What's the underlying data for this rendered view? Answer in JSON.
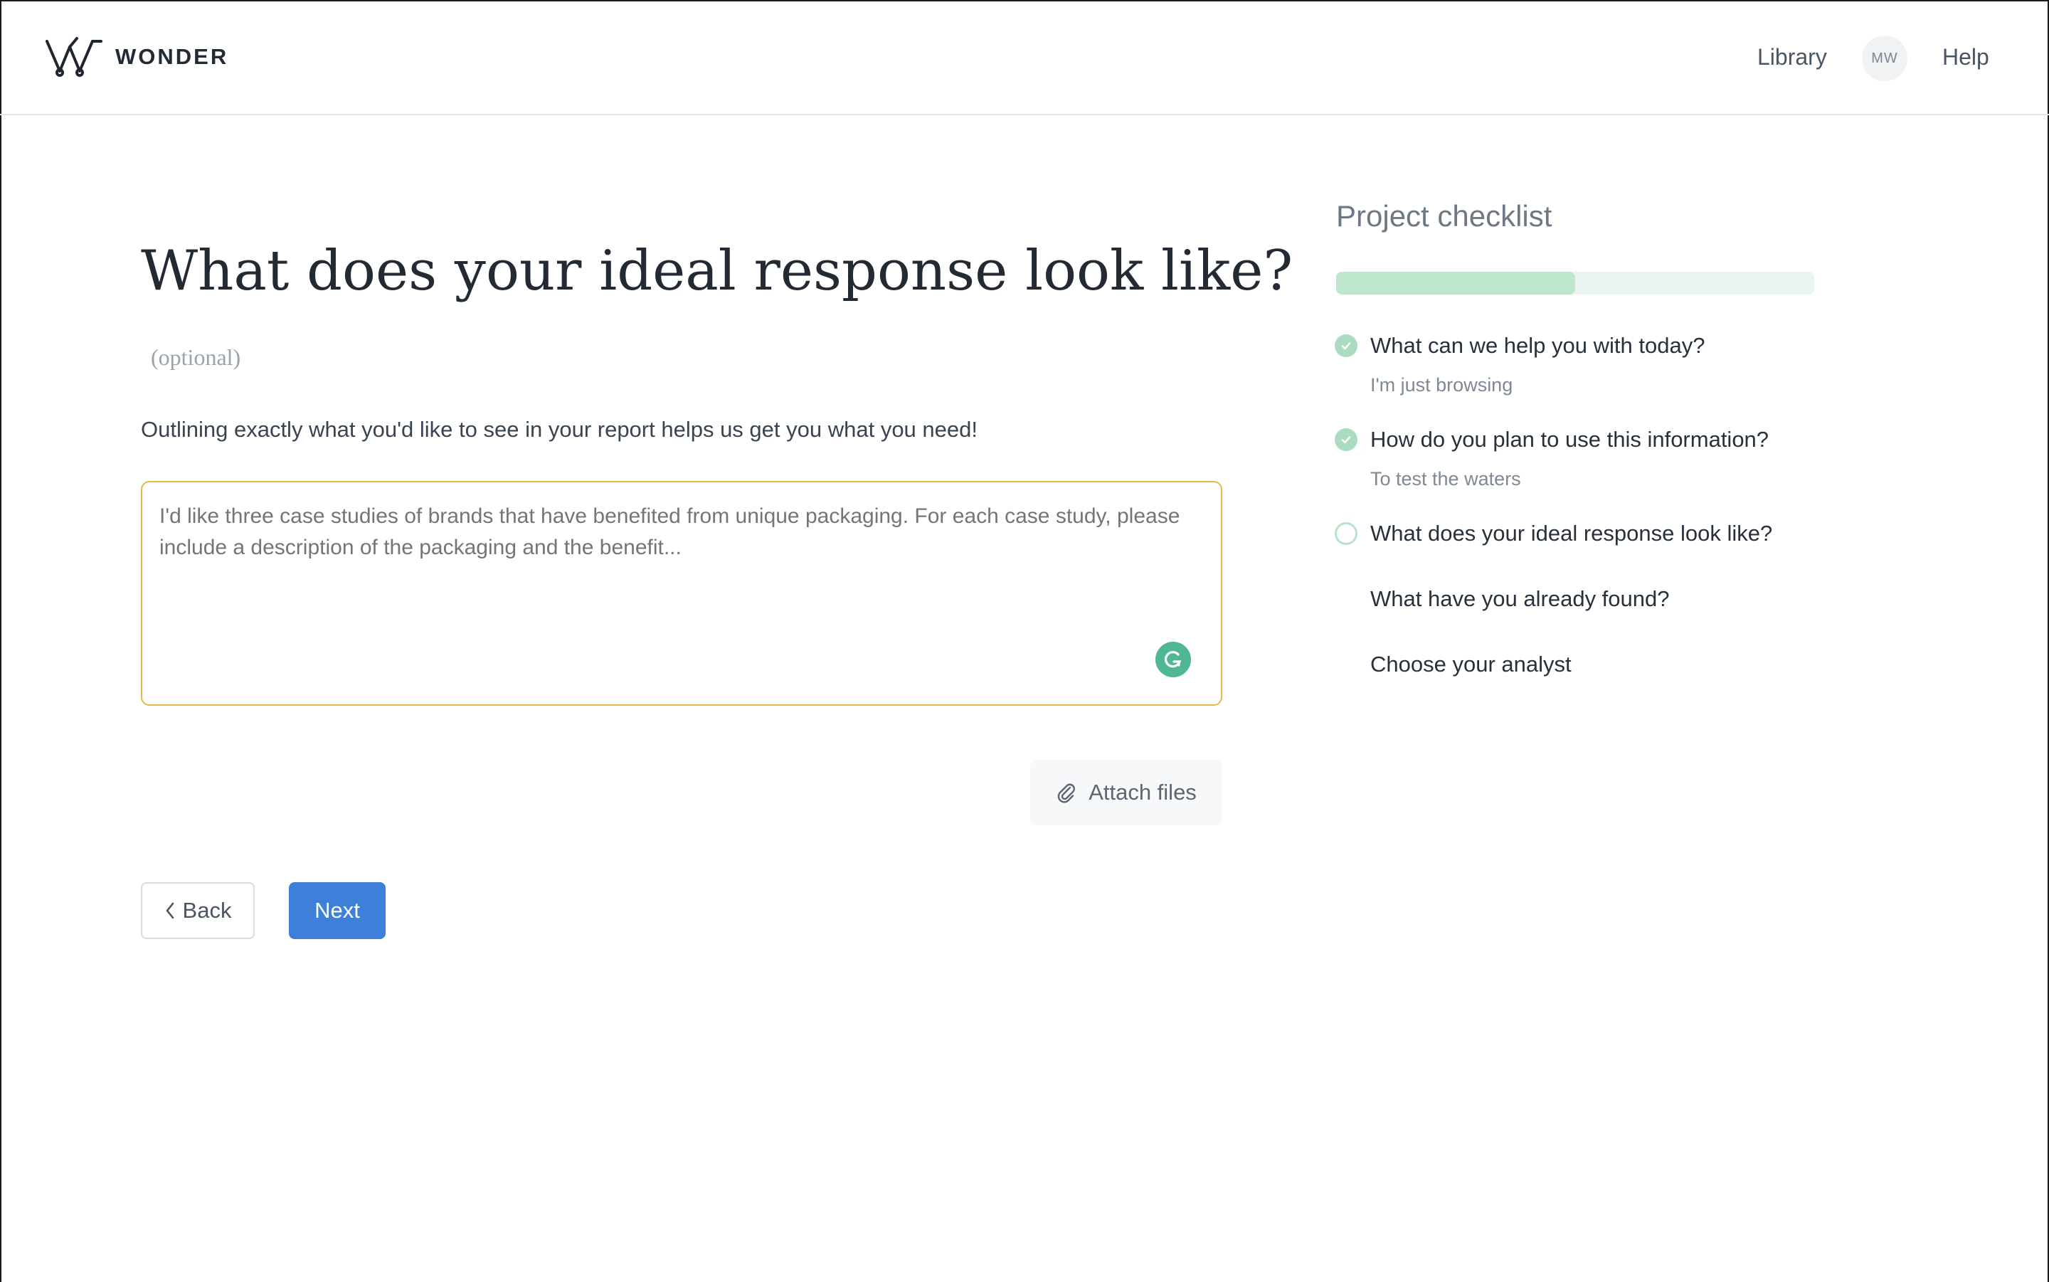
{
  "brand": {
    "name": "WONDER",
    "logo_icon": "wonder-w-logo"
  },
  "header": {
    "library_label": "Library",
    "avatar_initials": "MW",
    "help_label": "Help"
  },
  "main": {
    "title": "What does your ideal response look like?",
    "optional_label": "(optional)",
    "description": "Outlining exactly what you'd like to see in your report helps us get you what you need!",
    "response_placeholder": "I'd like three case studies of brands that have benefited from unique packaging. For each case study, please include a description of the packaging and the benefit...",
    "response_value": "",
    "grammarly_icon": "grammarly-icon",
    "attach_label": "Attach files",
    "back_label": "Back",
    "next_label": "Next"
  },
  "checklist": {
    "title": "Project checklist",
    "progress_fraction": 0.5,
    "items": [
      {
        "label": "What can we help you with today?",
        "status": "done",
        "answer": "I'm just browsing"
      },
      {
        "label": "How do you plan to use this information?",
        "status": "done",
        "answer": "To test the waters"
      },
      {
        "label": "What does your ideal response look like?",
        "status": "current",
        "answer": ""
      },
      {
        "label": "What have you already found?",
        "status": "pending",
        "answer": ""
      },
      {
        "label": "Choose your analyst",
        "status": "pending",
        "answer": ""
      }
    ]
  },
  "colors": {
    "accent": "#3d7fd9",
    "input_focus_border": "#e8b847",
    "progress_fill": "#bde6cc",
    "progress_track": "#e9f5ee",
    "check_done": "#a9dcc0",
    "grammarly": "#4fb792"
  }
}
